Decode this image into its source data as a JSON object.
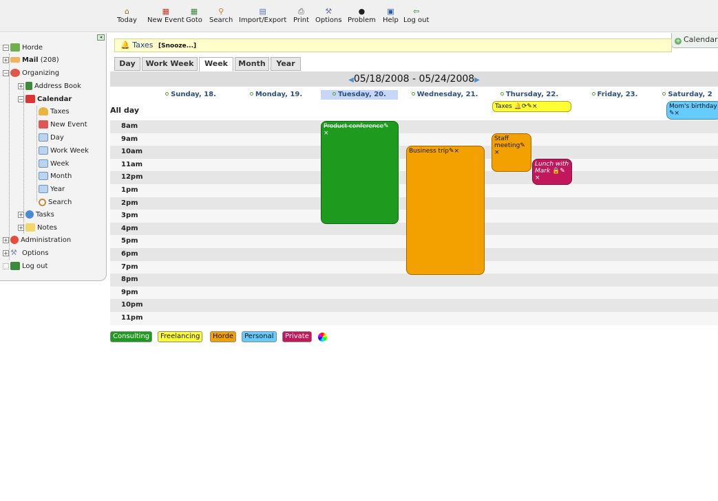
{
  "toolbar": {
    "items": [
      {
        "label": "Today",
        "icon": "home-icon",
        "glyph": "🏠"
      },
      {
        "label": "New Event",
        "icon": "new-event-icon",
        "glyph": "📅"
      },
      {
        "label": "Goto",
        "icon": "goto-icon",
        "glyph": "📅"
      },
      {
        "label": "Search",
        "icon": "search-icon",
        "glyph": "🔍"
      },
      {
        "label": "Import/Export",
        "icon": "import-export-icon",
        "glyph": "📄"
      },
      {
        "label": "Print",
        "icon": "print-icon",
        "glyph": "🖨"
      },
      {
        "label": "Options",
        "icon": "wrench-icon",
        "glyph": "🔧"
      },
      {
        "label": "Problem",
        "icon": "bomb-icon",
        "glyph": "💣"
      },
      {
        "label": "Help",
        "icon": "help-book-icon",
        "glyph": "📖"
      },
      {
        "label": "Log out",
        "icon": "logout-icon",
        "glyph": "🚪"
      }
    ]
  },
  "sidebar": {
    "items": [
      {
        "label": "Horde"
      },
      {
        "label": "Mail",
        "count": "(208)"
      },
      {
        "label": "Organizing"
      },
      {
        "label": "Address Book"
      },
      {
        "label": "Calendar"
      },
      {
        "label": "Taxes"
      },
      {
        "label": "New Event"
      },
      {
        "label": "Day"
      },
      {
        "label": "Work Week"
      },
      {
        "label": "Week"
      },
      {
        "label": "Month"
      },
      {
        "label": "Year"
      },
      {
        "label": "Search"
      },
      {
        "label": "Tasks"
      },
      {
        "label": "Notes"
      },
      {
        "label": "Administration"
      },
      {
        "label": "Options"
      },
      {
        "label": "Log out"
      }
    ]
  },
  "alarm": {
    "title": "Taxes",
    "snooze": "[Snooze...]"
  },
  "new_calendar": {
    "label": "Calendar"
  },
  "tabs": [
    "Day",
    "Work Week",
    "Week",
    "Month",
    "Year"
  ],
  "active_tab": "Week",
  "date_range": "05/18/2008 - 05/24/2008",
  "days": [
    "Sunday, 18.",
    "Monday, 19.",
    "Tuesday, 20.",
    "Wednesday, 21.",
    "Thursday, 22.",
    "Friday, 23.",
    "Saturday, 2"
  ],
  "allday_label": "All day",
  "hours": [
    "8am",
    "9am",
    "10am",
    "11am",
    "12pm",
    "1pm",
    "2pm",
    "3pm",
    "4pm",
    "5pm",
    "6pm",
    "7pm",
    "8pm",
    "9pm",
    "10pm",
    "11pm"
  ],
  "events": {
    "taxes": {
      "title": "Taxes",
      "icons": "🔔⟳✎×"
    },
    "birthday": {
      "title": "Mom's birthday",
      "icons": "✎×"
    },
    "product": {
      "title": "Product conference",
      "icons": "✎ ×"
    },
    "business": {
      "title": "Business trip",
      "icons": "✎×"
    },
    "staff": {
      "title": "Staff meeting",
      "icons": "✎ ×"
    },
    "lunch": {
      "title": "Lunch with Mark",
      "icons": "🔒✎ ×"
    }
  },
  "legend": [
    "Consulting",
    "Freelancing",
    "Horde",
    "Personal",
    "Private"
  ],
  "colors": {
    "Consulting": "#1e9a1e",
    "Freelancing": "#ffff33",
    "Horde": "#f2a100",
    "Personal": "#66ccff",
    "Private": "#c2185b"
  }
}
